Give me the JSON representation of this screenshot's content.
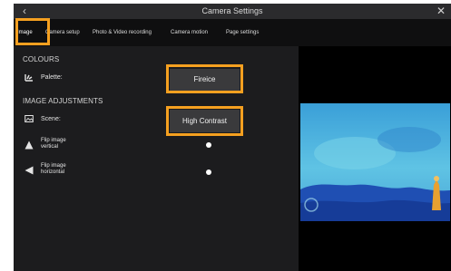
{
  "window": {
    "title": "Camera Settings",
    "back_icon": "chevron-left-icon",
    "close_icon": "close-icon",
    "accent_highlight": "#f5a020"
  },
  "tabs": [
    {
      "label": "Image",
      "active": true
    },
    {
      "label": "Camera setup",
      "active": false
    },
    {
      "label": "Photo & Video recording",
      "active": false
    },
    {
      "label": "Camera motion",
      "active": false
    },
    {
      "label": "Page settings",
      "active": false
    }
  ],
  "colours": {
    "heading": "COLOURS",
    "palette_label": "Palette:",
    "palette_value": "Fireice"
  },
  "image_adjustments": {
    "heading": "IMAGE ADJUSTMENTS",
    "scene_label": "Scene:",
    "scene_value": "High Contrast",
    "flip_vertical_label_line1": "Flip image",
    "flip_vertical_label_line2": "vertical",
    "flip_vertical_on": false,
    "flip_horizontal_label_line1": "Flip image",
    "flip_horizontal_label_line2": "horizontal",
    "flip_horizontal_on": false
  },
  "preview": {
    "palette_colors": [
      "#3aa4dc",
      "#58c6e0",
      "#1f4fb3",
      "#e8a030"
    ]
  }
}
